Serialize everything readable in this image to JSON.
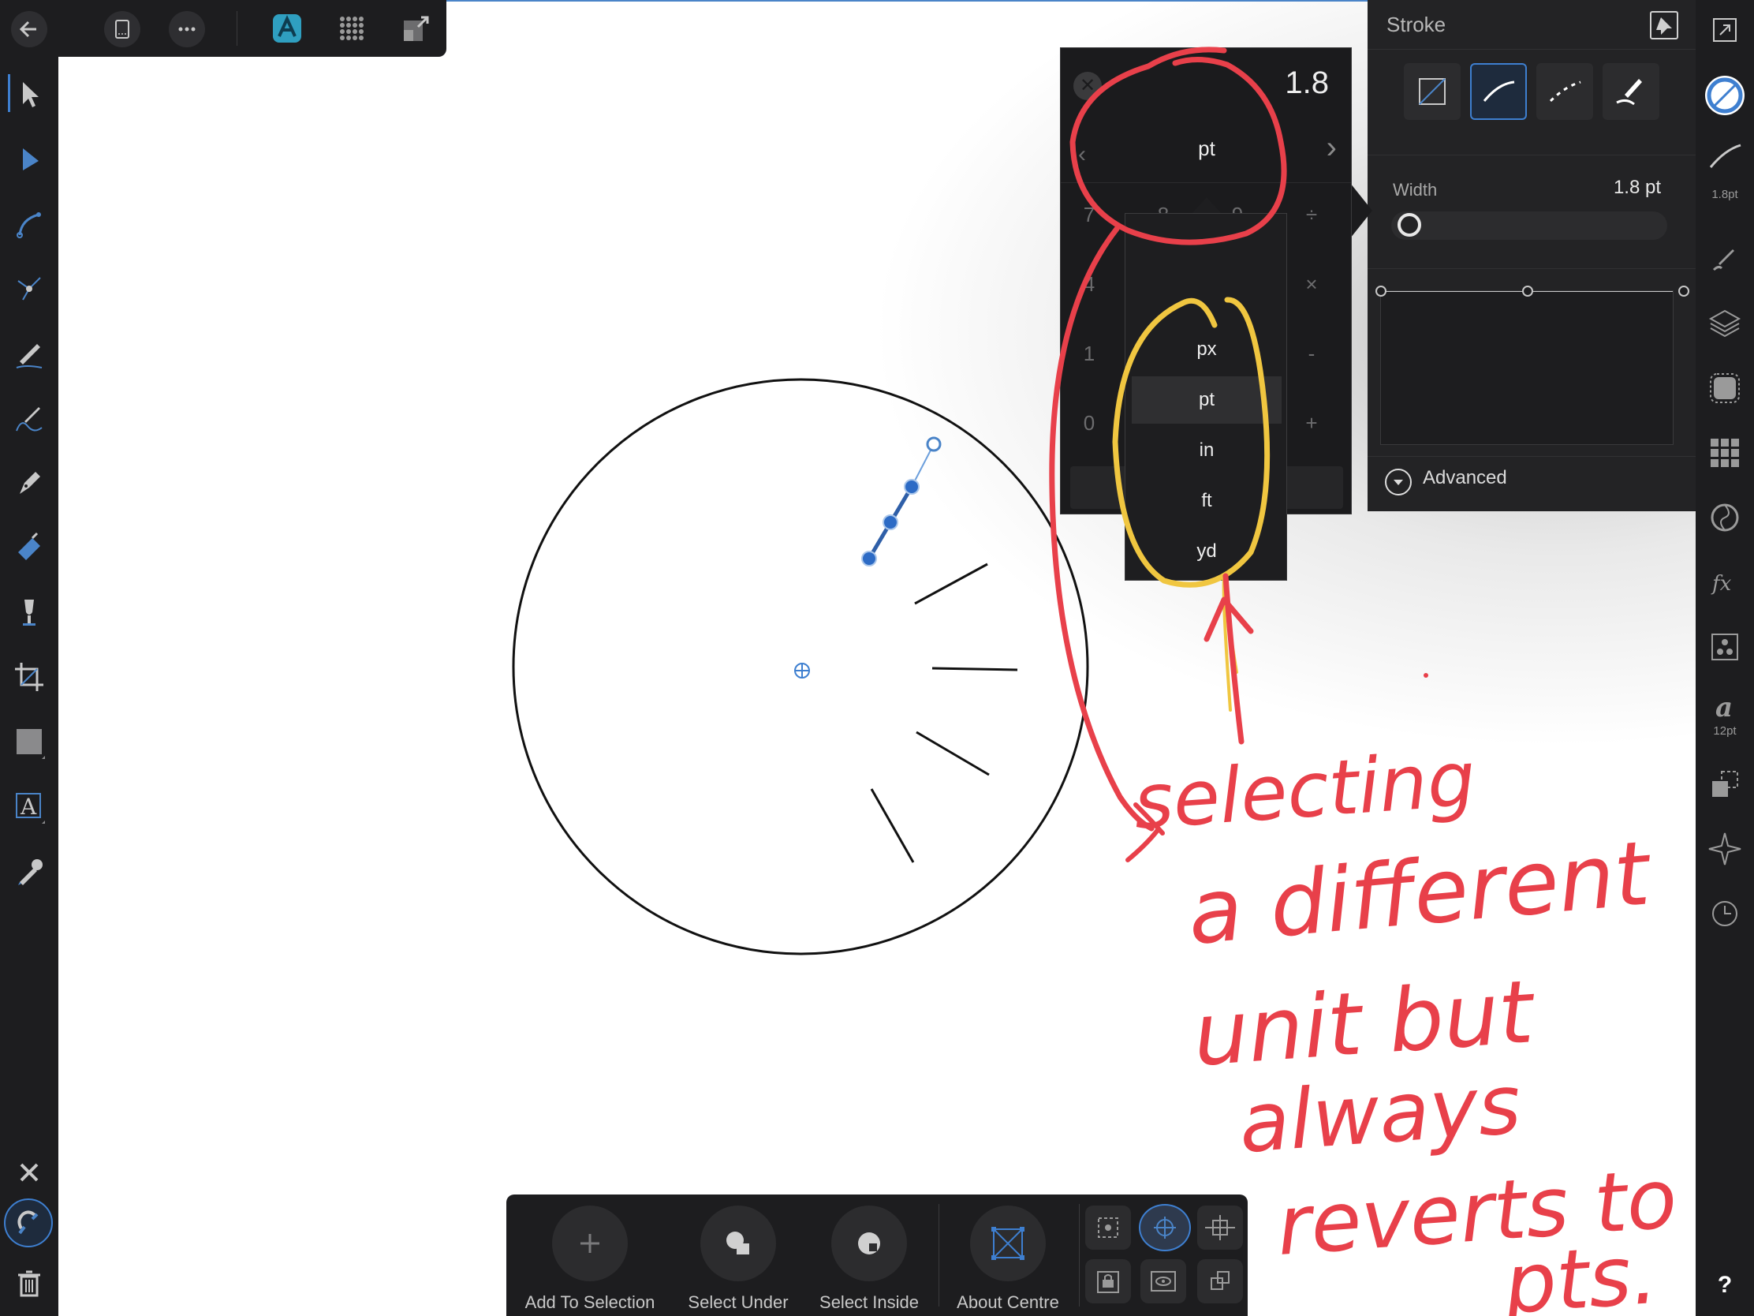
{
  "top_toolbar": {
    "buttons": [
      {
        "name": "back-arrow-icon"
      },
      {
        "name": "document-icon"
      },
      {
        "name": "more-icon"
      },
      {
        "name": "app-persona-icon"
      },
      {
        "name": "grid-view-icon"
      },
      {
        "name": "export-persona-icon"
      }
    ]
  },
  "stroke_panel": {
    "title": "Stroke",
    "style_types": [
      "none-style-icon",
      "solid-line-icon",
      "dashed-line-icon",
      "brush-stroke-icon"
    ],
    "selected_style": 1,
    "width_label": "Width",
    "width_value": "1.8 pt",
    "width_fraction": 0.02,
    "advanced_label": "Advanced"
  },
  "calculator": {
    "display": "1.8",
    "unit": "pt",
    "keys": {
      "row1": [
        "7",
        "8",
        "9",
        "÷"
      ],
      "row2": [
        "4",
        "×"
      ],
      "row3": [
        "1",
        "-"
      ],
      "row4": [
        "0",
        "+"
      ]
    }
  },
  "unit_menu": {
    "items": [
      "px",
      "pt",
      "in",
      "ft",
      "yd"
    ],
    "selected": "pt"
  },
  "right_toolbar": {
    "stroke_size_label": "1.8pt",
    "font_size_label": "12pt",
    "help_label": "?"
  },
  "bottom_toolbar": {
    "buttons": [
      {
        "label": "Add To Selection"
      },
      {
        "label": "Select Under"
      },
      {
        "label": "Select Inside"
      },
      {
        "label": "About Centre"
      }
    ]
  },
  "annotation": {
    "lines": [
      "selecting",
      "a different",
      "unit but",
      "always",
      "reverts to",
      "pts."
    ],
    "color": "#e8404a"
  },
  "colors": {
    "accent": "#3e7fd0",
    "panel": "#232325",
    "annotation_red": "#e8404a",
    "annotation_yellow": "#f0c640"
  }
}
